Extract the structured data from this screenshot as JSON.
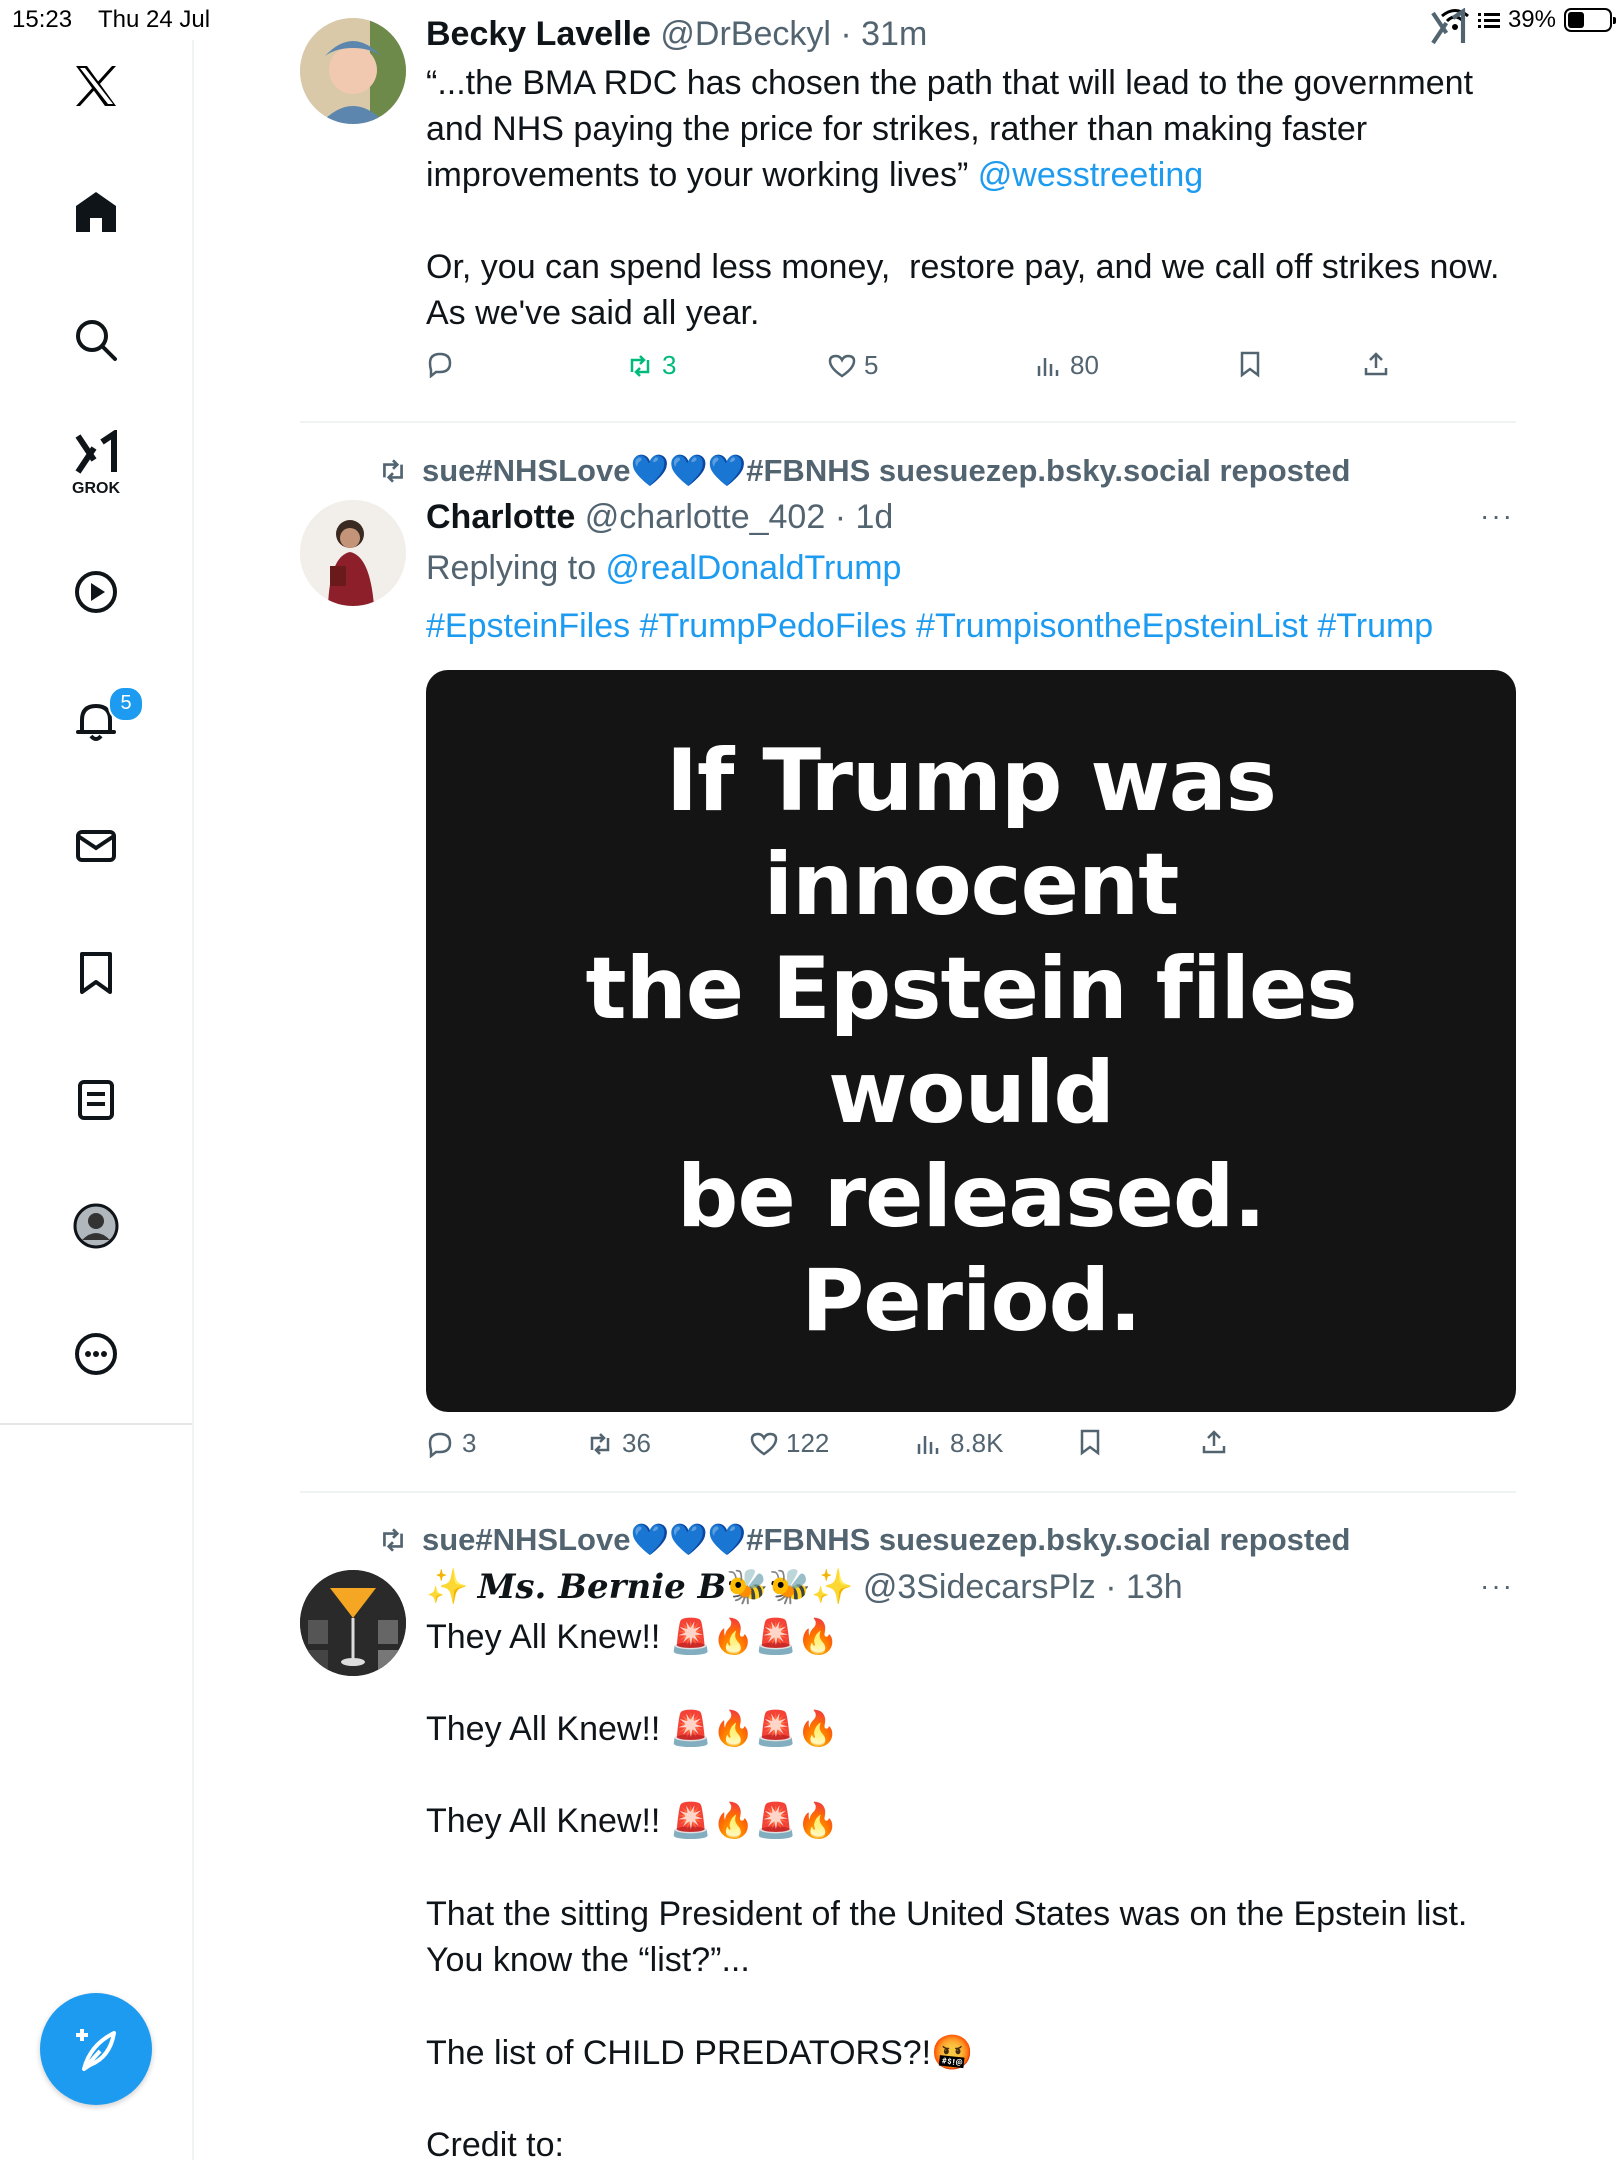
{
  "status_bar": {
    "time": "15:23",
    "date": "Thu 24 Jul",
    "battery": "39%",
    "battery_level": 0.39
  },
  "sidebar": {
    "grok_label": "GROK",
    "notifications_badge": "5"
  },
  "tweets": [
    {
      "name": "Becky Lavelle",
      "handle": "@DrBeckyl",
      "time": "· 31m",
      "text_1": "“...the BMA RDC has chosen the path that will lead to the government and NHS paying the price for strikes, rather than making faster improvements to your working lives” ",
      "mention": "@wesstreeting",
      "text_2": "Or, you can spend less money,  restore pay, and we call off strikes now. As we've said all year.",
      "reposts": "3",
      "likes": "5",
      "views": "80"
    },
    {
      "reposted_by": "sue#NHSLove💙💙💙#FBNHS suesuezep.bsky.social reposted",
      "name": "Charlotte",
      "handle": "@charlotte_402",
      "time": "· 1d",
      "replying_prefix": "Replying to ",
      "replying_to": "@realDonaldTrump",
      "hashtags": "#EpsteinFiles #TrumpPedoFiles #TrumpisontheEpsteinList #Trump",
      "image_text": "If Trump was innocent\nthe Epstein files would\nbe released.\nPeriod.",
      "replies": "3",
      "reposts": "36",
      "likes": "122",
      "views": "8.8K"
    },
    {
      "reposted_by": "sue#NHSLove💙💙💙#FBNHS suesuezep.bsky.social reposted",
      "name_prefix": "✨ ",
      "name": "Ms. Bernie B",
      "name_suffix": "🐝🐝✨",
      "handle": "@3SidecarsPlz",
      "time": "· 13h",
      "line": "They All Knew!!",
      "emojis": "🚨🔥🚨🔥",
      "para_2": "That the sitting President of the United States was on the Epstein list. You know the “list?”...",
      "para_3": "The list of CHILD PREDATORS?!🤬",
      "para_4": "Credit to:"
    }
  ],
  "more_label": "···"
}
